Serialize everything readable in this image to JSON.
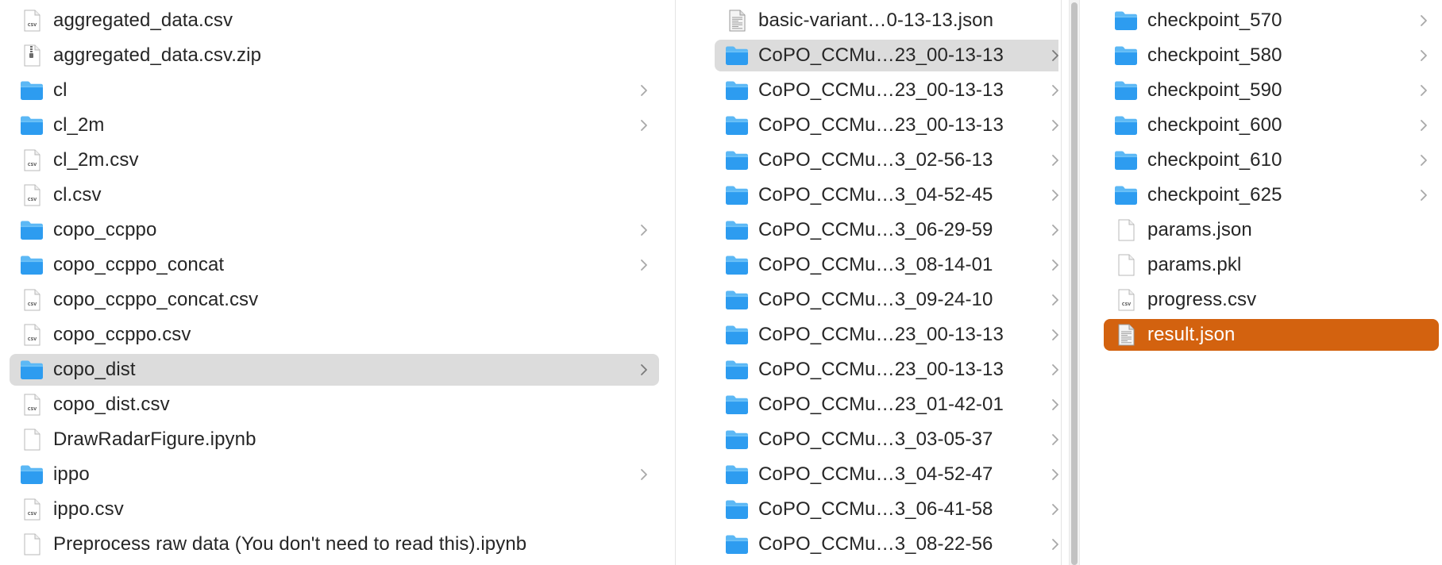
{
  "columns": [
    {
      "items": [
        {
          "name": "aggregated_data.csv",
          "kind": "csv"
        },
        {
          "name": "aggregated_data.csv.zip",
          "kind": "zip"
        },
        {
          "name": "cl",
          "kind": "folder"
        },
        {
          "name": "cl_2m",
          "kind": "folder"
        },
        {
          "name": "cl_2m.csv",
          "kind": "csv"
        },
        {
          "name": "cl.csv",
          "kind": "csv"
        },
        {
          "name": "copo_ccppo",
          "kind": "folder"
        },
        {
          "name": "copo_ccppo_concat",
          "kind": "folder"
        },
        {
          "name": "copo_ccppo_concat.csv",
          "kind": "csv"
        },
        {
          "name": "copo_ccppo.csv",
          "kind": "csv"
        },
        {
          "name": "copo_dist",
          "kind": "folder",
          "selected": "grey"
        },
        {
          "name": "copo_dist.csv",
          "kind": "csv"
        },
        {
          "name": "DrawRadarFigure.ipynb",
          "kind": "doc"
        },
        {
          "name": "ippo",
          "kind": "folder"
        },
        {
          "name": "ippo.csv",
          "kind": "csv"
        },
        {
          "name": "Preprocess raw data (You don't need to read this).ipynb",
          "kind": "doc"
        }
      ]
    },
    {
      "items": [
        {
          "name": "basic-variant…0-13-13.json",
          "kind": "json"
        },
        {
          "name": "CoPO_CCMu…23_00-13-13",
          "kind": "folder",
          "selected": "grey"
        },
        {
          "name": "CoPO_CCMu…23_00-13-13",
          "kind": "folder"
        },
        {
          "name": "CoPO_CCMu…23_00-13-13",
          "kind": "folder"
        },
        {
          "name": "CoPO_CCMu…3_02-56-13",
          "kind": "folder"
        },
        {
          "name": "CoPO_CCMu…3_04-52-45",
          "kind": "folder"
        },
        {
          "name": "CoPO_CCMu…3_06-29-59",
          "kind": "folder"
        },
        {
          "name": "CoPO_CCMu…3_08-14-01",
          "kind": "folder"
        },
        {
          "name": "CoPO_CCMu…3_09-24-10",
          "kind": "folder"
        },
        {
          "name": "CoPO_CCMu…23_00-13-13",
          "kind": "folder"
        },
        {
          "name": "CoPO_CCMu…23_00-13-13",
          "kind": "folder"
        },
        {
          "name": "CoPO_CCMu…23_01-42-01",
          "kind": "folder"
        },
        {
          "name": "CoPO_CCMu…3_03-05-37",
          "kind": "folder"
        },
        {
          "name": "CoPO_CCMu…3_04-52-47",
          "kind": "folder"
        },
        {
          "name": "CoPO_CCMu…3_06-41-58",
          "kind": "folder"
        },
        {
          "name": "CoPO_CCMu…3_08-22-56",
          "kind": "folder"
        }
      ]
    },
    {
      "items": [
        {
          "name": "checkpoint_570",
          "kind": "folder"
        },
        {
          "name": "checkpoint_580",
          "kind": "folder"
        },
        {
          "name": "checkpoint_590",
          "kind": "folder"
        },
        {
          "name": "checkpoint_600",
          "kind": "folder"
        },
        {
          "name": "checkpoint_610",
          "kind": "folder"
        },
        {
          "name": "checkpoint_625",
          "kind": "folder"
        },
        {
          "name": "params.json",
          "kind": "doc"
        },
        {
          "name": "params.pkl",
          "kind": "doc"
        },
        {
          "name": "progress.csv",
          "kind": "csv"
        },
        {
          "name": "result.json",
          "kind": "json",
          "selected": "orange"
        }
      ]
    }
  ],
  "icons": {
    "csv": "csv-file-icon",
    "zip": "zip-file-icon",
    "folder": "folder-icon",
    "doc": "document-icon",
    "json": "json-file-icon",
    "chevron": "chevron-right-icon"
  },
  "file_badges": {
    "csv": "CSV"
  },
  "colors": {
    "folder_top": "#5cb8f5",
    "folder_body": "#2d9cf0",
    "selection_grey": "#dcdcdc",
    "selection_orange": "#d3620f",
    "text": "#262626"
  }
}
